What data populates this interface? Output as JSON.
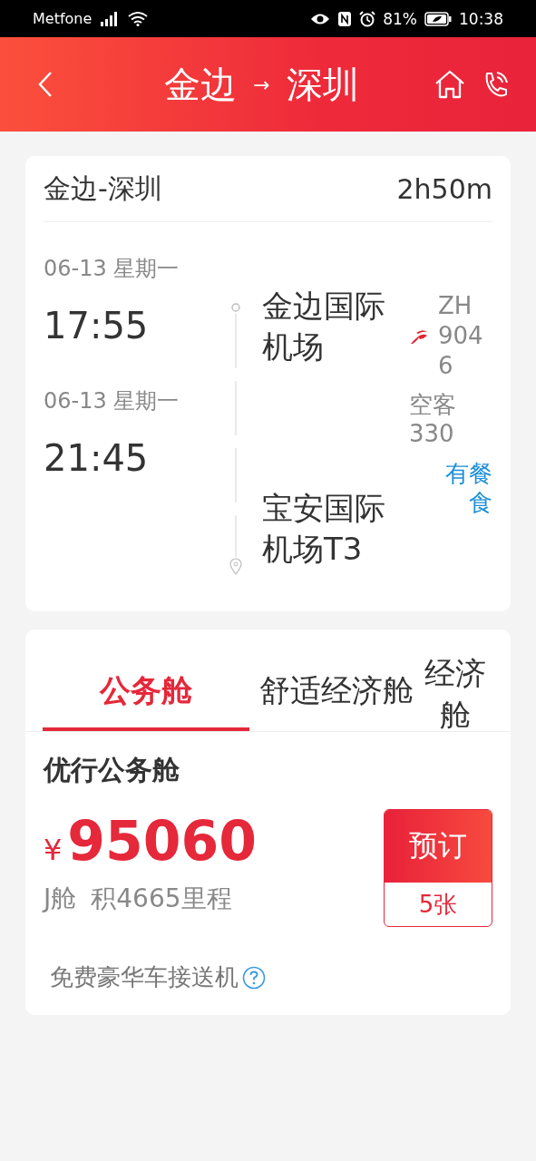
{
  "status_bar": {
    "carrier": "Metfone",
    "battery": "81%",
    "time": "10:38"
  },
  "header": {
    "from": "金边",
    "arrow": "→",
    "to": "深圳"
  },
  "flight": {
    "route": "金边-深圳",
    "duration": "2h50m",
    "departure": {
      "date": "06-13 星期一",
      "time": "17:55",
      "airport": "金边国际机场"
    },
    "arrival": {
      "date": "06-13 星期一",
      "time": "21:45",
      "airport": "宝安国际机场T3"
    },
    "flight_no": "ZH 9046",
    "aircraft": "空客330",
    "meal": "有餐食"
  },
  "cabin_tabs": [
    {
      "label": "公务舱",
      "selected": true
    },
    {
      "label": "舒适经济舱",
      "selected": false
    },
    {
      "label": "经济舱",
      "selected": false
    }
  ],
  "fare": {
    "name": "优行公务舱",
    "currency": "¥",
    "price": "95060",
    "cabin_class": "J舱",
    "miles": "积4665里程",
    "book_label": "预订",
    "tickets_left": "5张",
    "perk": "免费豪华车接送机"
  }
}
